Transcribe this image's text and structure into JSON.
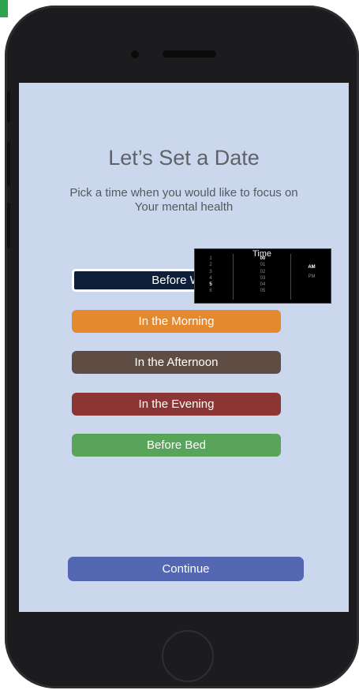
{
  "screen": {
    "title": "Let’s Set a Date",
    "subtitle_line1": "Pick a time when you would like to focus on",
    "subtitle_line2": "Your mental health"
  },
  "options": {
    "before_work": "Before W",
    "morning": "In the Morning",
    "afternoon": "In the Afternoon",
    "evening": "In the Evening",
    "bed": "Before Bed"
  },
  "continue_label": "Continue",
  "time_picker": {
    "title": "Time",
    "hours": [
      "1",
      "2",
      "3",
      "4",
      "5",
      "6"
    ],
    "selected_hour": "5",
    "minutes": [
      "00",
      "01",
      "02",
      "03",
      "04",
      "05"
    ],
    "selected_minute": "00",
    "periods": [
      "AM",
      "PM"
    ],
    "selected_period": "AM"
  },
  "colors": {
    "screen_bg": "#cbd7ec",
    "selected_option": "#0f1f3a",
    "morning": "#e5892e",
    "afternoon": "#5f4c42",
    "evening": "#8b3535",
    "bed": "#58a45a",
    "continue": "#5367b3"
  }
}
